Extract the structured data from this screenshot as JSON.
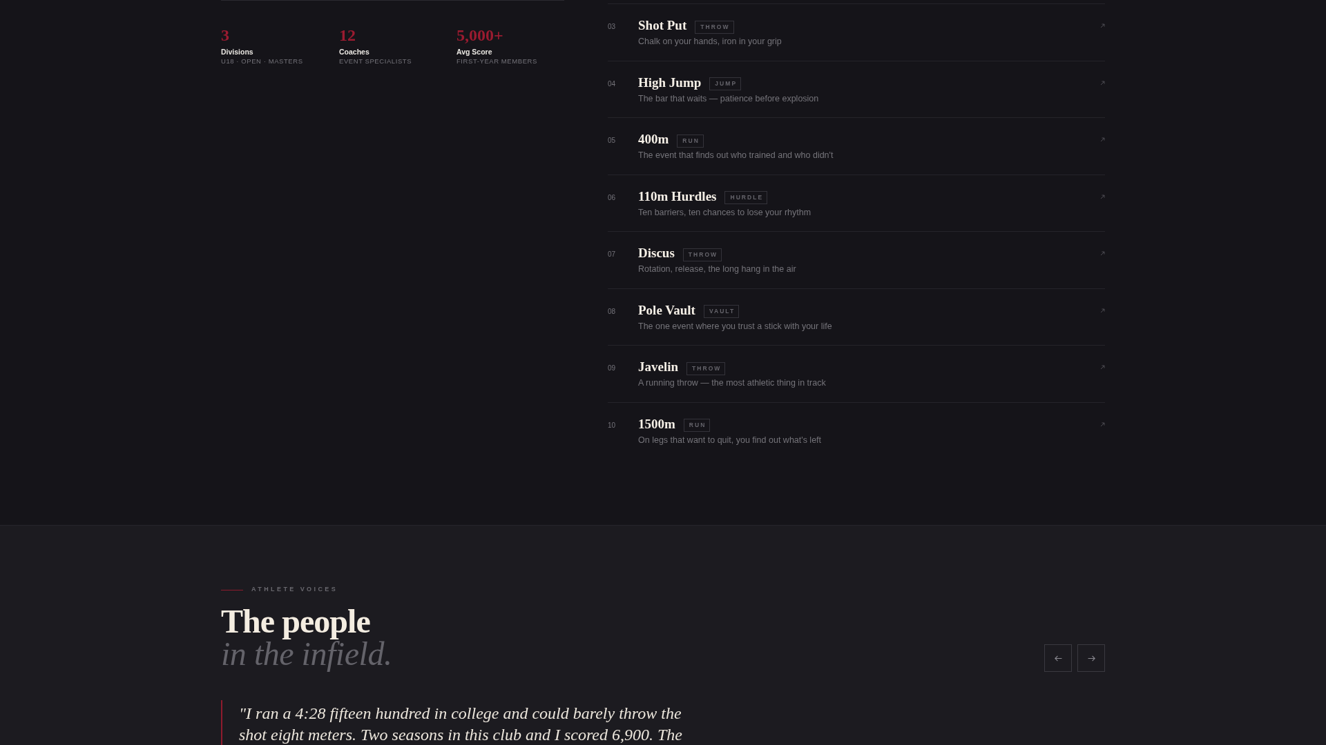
{
  "stats": [
    {
      "value": "3",
      "label": "Divisions",
      "caption": "U18 · OPEN · MASTERS"
    },
    {
      "value": "12",
      "label": "Coaches",
      "caption": "EVENT SPECIALISTS"
    },
    {
      "value": "5,000+",
      "label": "Avg Score",
      "caption": "FIRST-YEAR MEMBERS"
    }
  ],
  "events": [
    {
      "number": "03",
      "name": "Shot Put",
      "tag": "THROW",
      "description": "Chalk on your hands, iron in your grip"
    },
    {
      "number": "04",
      "name": "High Jump",
      "tag": "JUMP",
      "description": "The bar that waits — patience before explosion"
    },
    {
      "number": "05",
      "name": "400m",
      "tag": "RUN",
      "description": "The event that finds out who trained and who didn't"
    },
    {
      "number": "06",
      "name": "110m Hurdles",
      "tag": "HURDLE",
      "description": "Ten barriers, ten chances to lose your rhythm"
    },
    {
      "number": "07",
      "name": "Discus",
      "tag": "THROW",
      "description": "Rotation, release, the long hang in the air"
    },
    {
      "number": "08",
      "name": "Pole Vault",
      "tag": "VAULT",
      "description": "The one event where you trust a stick with your life"
    },
    {
      "number": "09",
      "name": "Javelin",
      "tag": "THROW",
      "description": "A running throw — the most athletic thing in track"
    },
    {
      "number": "10",
      "name": "1500m",
      "tag": "RUN",
      "description": "On legs that want to quit, you find out what's left"
    }
  ],
  "testimonials": {
    "eyebrow": "ATHLETE VOICES",
    "heading": "The people",
    "heading_italic": "in the infield.",
    "quote": "\"I ran a 4:28 fifteen hundred in college and could barely throw the shot eight meters. Two seasons in this club and I scored 6,900. The"
  }
}
